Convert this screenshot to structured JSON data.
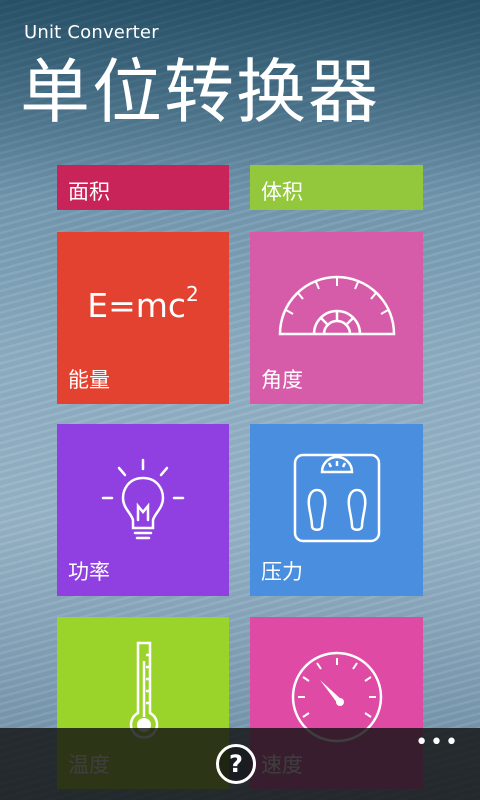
{
  "header": {
    "app_name": "Unit Converter",
    "title": "单位转换器"
  },
  "tiles": {
    "area": {
      "label": "面积",
      "color": "#c8245a"
    },
    "volume": {
      "label": "体积",
      "color": "#94c83c"
    },
    "energy": {
      "label": "能量",
      "formula_base": "E=mc",
      "formula_exp": "2",
      "color": "#e44230"
    },
    "angle": {
      "label": "角度",
      "color": "#d65caa"
    },
    "power": {
      "label": "功率",
      "color": "#9040e0"
    },
    "pressure": {
      "label": "压力",
      "color": "#4a8ee0"
    },
    "temperature": {
      "label": "温度",
      "color": "#9ad42a"
    },
    "speed": {
      "label": "速度",
      "color": "#de4aa4"
    }
  },
  "appbar": {
    "help_glyph": "?",
    "more_glyph": "•••"
  }
}
